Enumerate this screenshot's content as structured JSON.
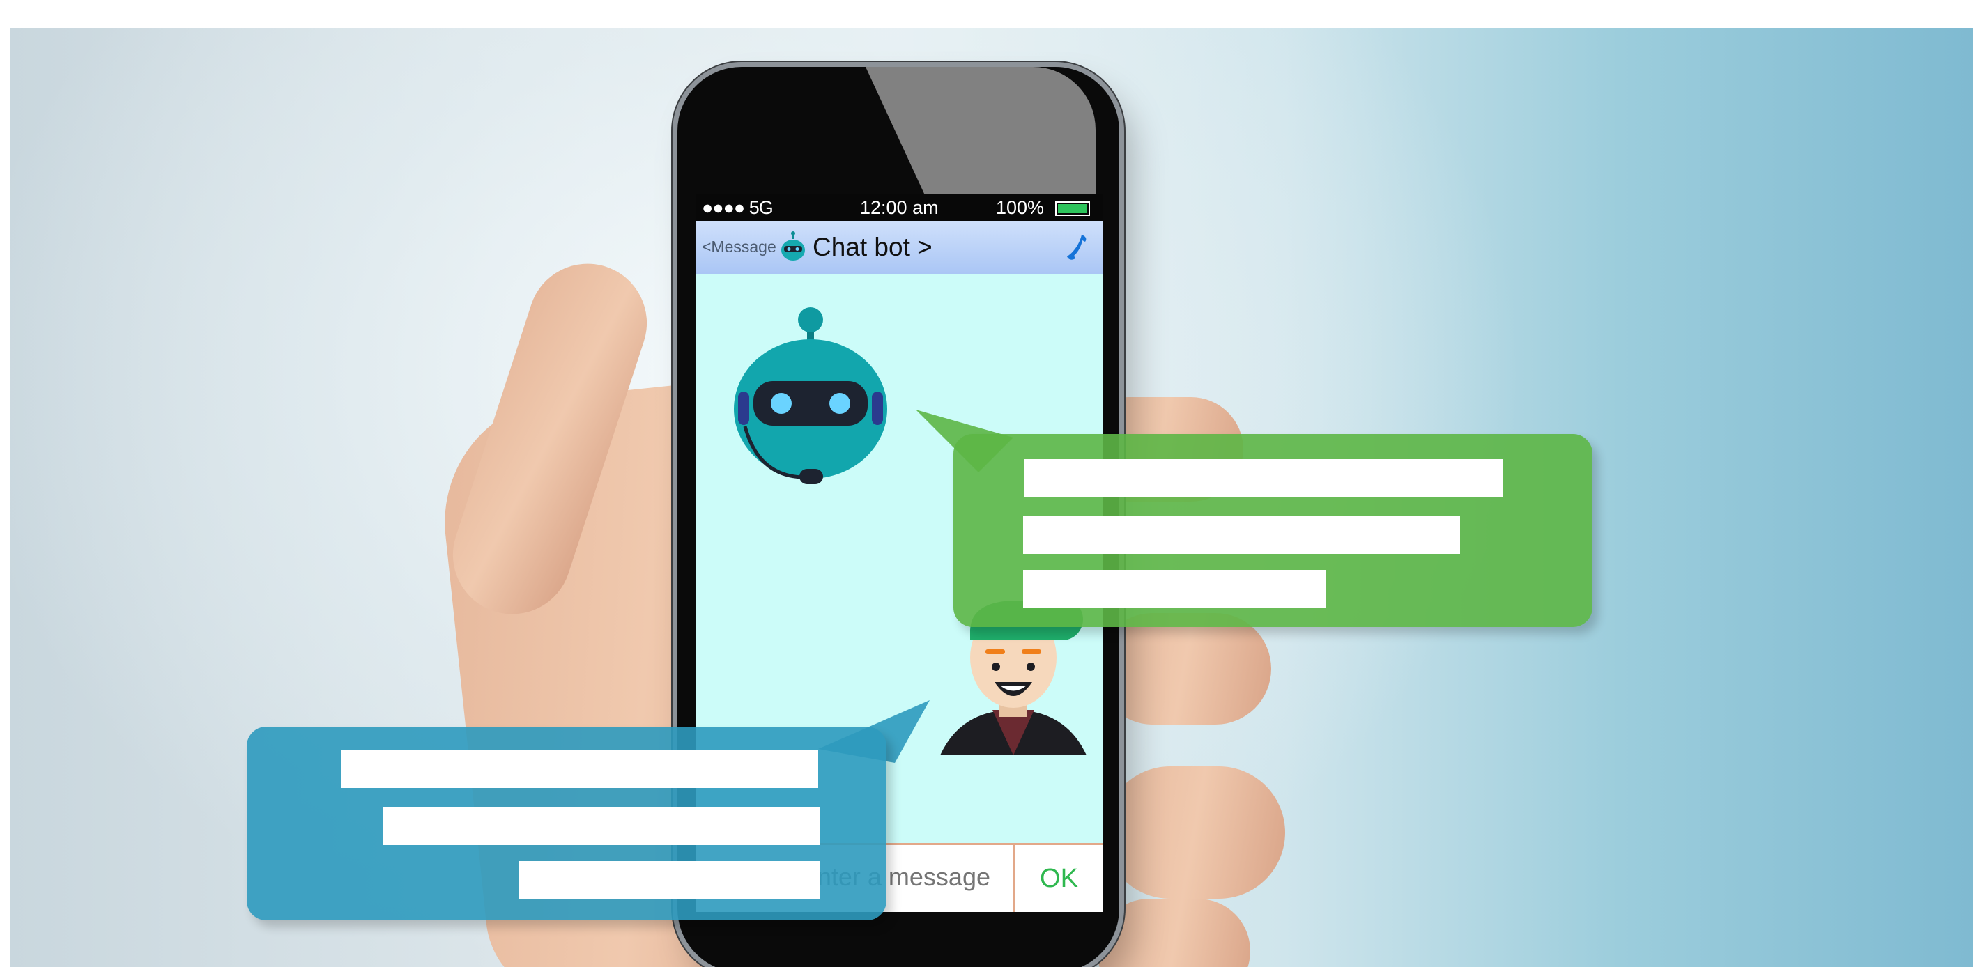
{
  "status_bar": {
    "signal": "●●●● 5G",
    "time": "12:00 am",
    "battery": "100%"
  },
  "header": {
    "back_label": "<Message",
    "title": "Chat bot >"
  },
  "composer": {
    "placeholder": "Enter a message",
    "send_label": "OK"
  },
  "colors": {
    "bot_bubble": "#5db646",
    "user_bubble": "#2e9abe",
    "screen": "#ccfcf9",
    "nav_bar": "#b8d0f8",
    "battery": "#2ec45c",
    "send_text": "#2fb84f"
  },
  "icons": [
    "robot-icon",
    "phone-call-icon",
    "battery-icon"
  ]
}
